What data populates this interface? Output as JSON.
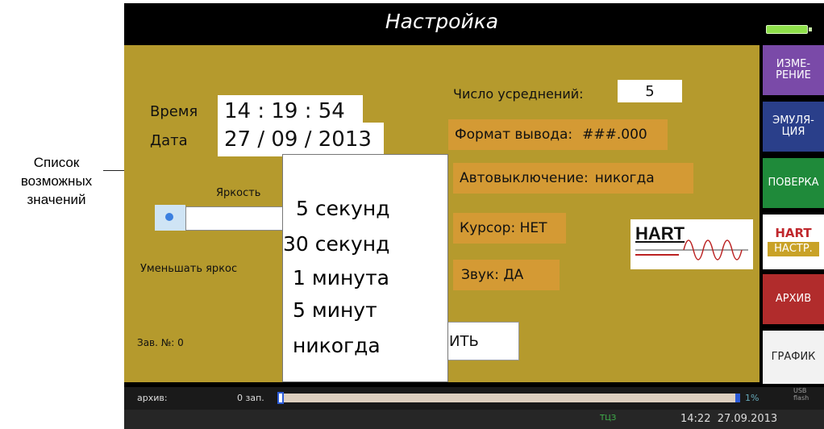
{
  "callout": {
    "lines": [
      "Список",
      "возможных",
      "значений"
    ]
  },
  "screen": {
    "title": "Настройка",
    "time_label": "Время",
    "time_value": "14 : 19 : 54",
    "date_label": "Дата",
    "date_value": "27 / 09 / 2013",
    "averaging_label": "Число усреднений:",
    "averaging_value": "5",
    "format_label": "Формат вывода:",
    "format_value": "###.000",
    "autooff_label": "Автовыключение:",
    "autooff_value": "никогда",
    "cursor_label": "Курсор: НЕТ",
    "sound_label": "Звук: ДА",
    "brightness_label": "Яркость",
    "dim_label": "Уменьшать яркос",
    "serial_label": "Зав. №: 0",
    "save_button_label": "ИТЬ",
    "hart_logo": "HART",
    "popup_options": [
      "5 секунд",
      "30 секунд",
      "1 минута",
      "5 минут",
      "никогда"
    ]
  },
  "tabs": [
    {
      "label": "ИЗМЕ-\nРЕНИЕ",
      "color": "#7a4aa8"
    },
    {
      "label": "ЭМУЛЯ-\nЦИЯ",
      "color": "#2a3f8a"
    },
    {
      "label": "ПОВЕРКА",
      "color": "#1f8a3a"
    },
    {
      "label": "HART",
      "sub": "НАСТР.",
      "color": "#c9a227"
    },
    {
      "label": "АРХИВ",
      "color": "#b12c2c"
    },
    {
      "label": "ГРАФИК",
      "color": "#f2f2f2"
    }
  ],
  "bottom": {
    "archive_label": "архив:",
    "records": "0 зап.",
    "percent": "1%",
    "usb": "USB\nflash",
    "tlz": "ТЦЗ",
    "clock": "14:22  27.09.2013",
    "archive_fill": 0.01
  }
}
